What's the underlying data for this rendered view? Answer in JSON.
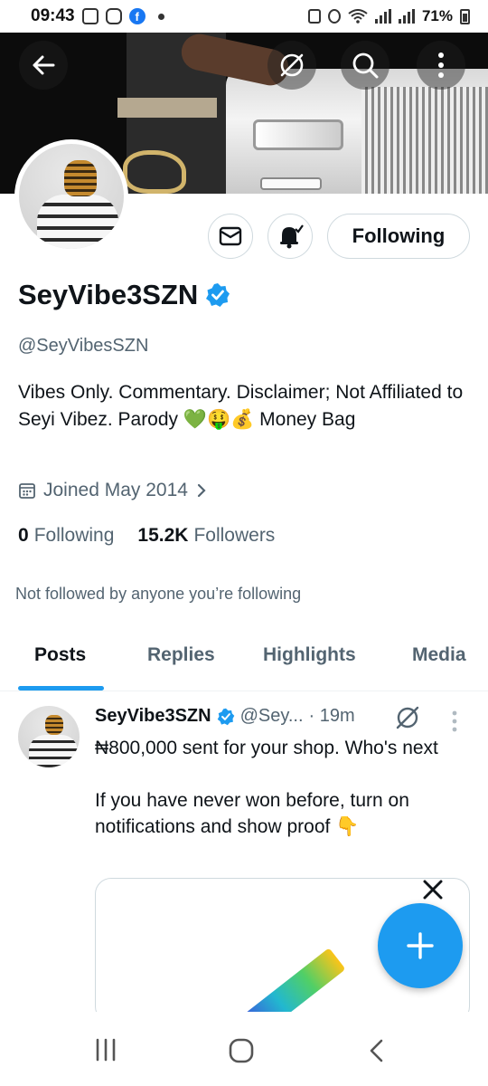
{
  "status_bar": {
    "time": "09:43",
    "battery": "71%",
    "icons": [
      "gallery-icon",
      "instagram-icon",
      "facebook-icon",
      "alarm-icon",
      "wifi-icon",
      "signal-icon"
    ]
  },
  "header": {
    "back_icon": "back-arrow-icon",
    "grok_icon": "grok-icon",
    "search_icon": "search-icon",
    "more_icon": "more-vertical-icon"
  },
  "profile": {
    "display_name": "SeyVibe3SZN",
    "handle": "@SeyVibesSZN",
    "bio": "Vibes Only. Commentary. Disclaimer; Not Affiliated to Seyi Vibez. Parody 💚🤑💰 Money Bag",
    "joined": "Joined May 2014",
    "following_count": "0",
    "following_label": "Following",
    "followers_count": "15.2K",
    "followers_label": "Followers",
    "not_followed_text": "Not followed by anyone you’re following",
    "follow_button": "Following",
    "verified_color": "#1d9bf0"
  },
  "tabs": [
    {
      "label": "Posts",
      "active": true
    },
    {
      "label": "Replies",
      "active": false
    },
    {
      "label": "Highlights",
      "active": false
    },
    {
      "label": "Media",
      "active": false
    }
  ],
  "post": {
    "name": "SeyVibe3SZN",
    "handle": "@Sey...",
    "time": "· 19m",
    "text": "₦800,000 sent for your shop. Who's next\n\nIf you have never won before,  turn on notifications and show proof 👇"
  },
  "colors": {
    "accent": "#1d9bf0",
    "secondary_text": "#536471",
    "primary_text": "#0f1419",
    "border": "#cfd9de"
  }
}
